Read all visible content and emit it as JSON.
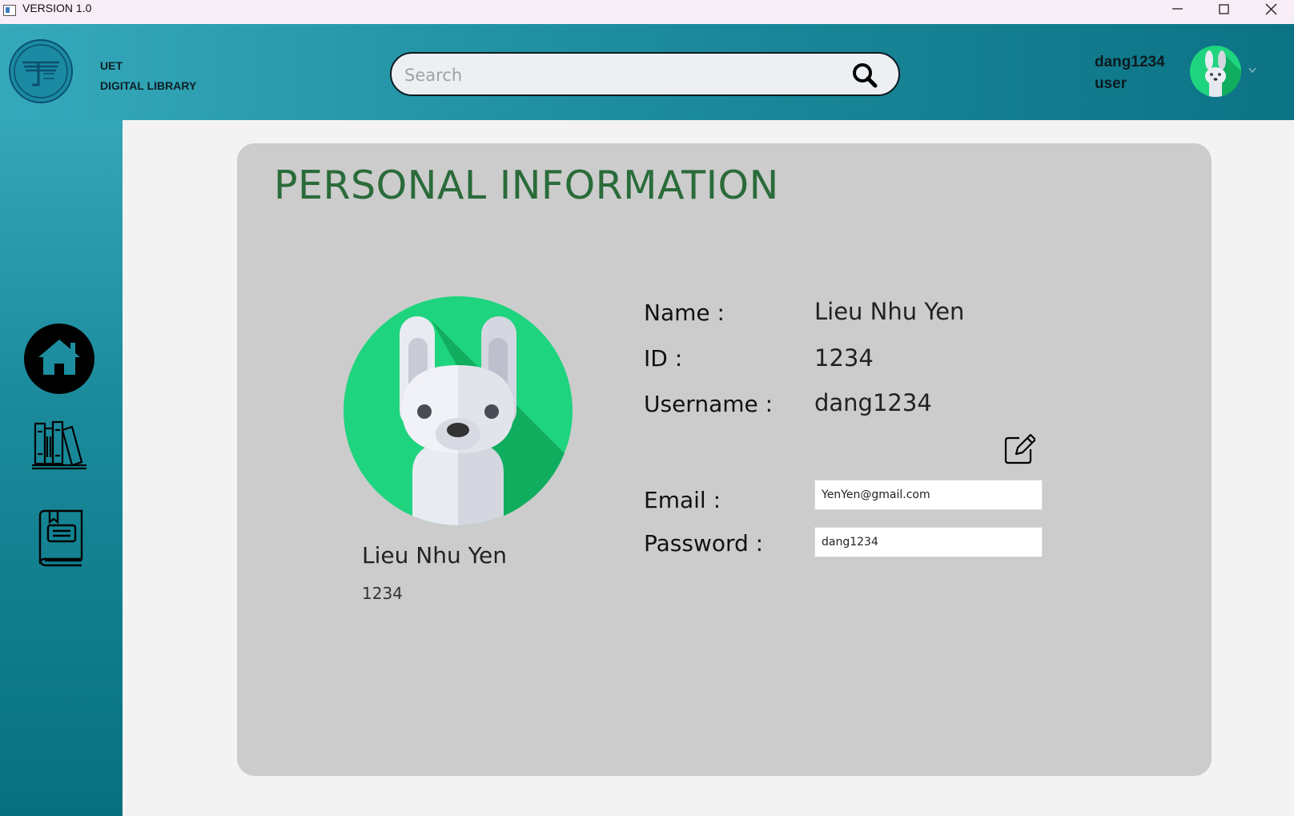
{
  "window": {
    "title": "VERSION 1.0"
  },
  "header": {
    "brand_line1": "UET",
    "brand_line2": "DIGITAL LIBRARY",
    "search_placeholder": "Search",
    "user_name": "dang1234",
    "user_role": "user"
  },
  "sidebar": {
    "items": [
      {
        "name": "home",
        "icon": "home-icon"
      },
      {
        "name": "library",
        "icon": "bookshelf-icon"
      },
      {
        "name": "my-books",
        "icon": "book-icon"
      }
    ]
  },
  "profile": {
    "title": "PERSONAL INFORMATION",
    "display_name": "Lieu Nhu Yen",
    "display_id": "1234",
    "name_label": "Name :",
    "name_value": "Lieu Nhu Yen",
    "id_label": "ID :",
    "id_value": "1234",
    "username_label": "Username :",
    "username_value": "dang1234",
    "email_label": "Email :",
    "email_value": "YenYen@gmail.com",
    "password_label": "Password :",
    "password_value": "dang1234"
  },
  "colors": {
    "header_start": "#35a9bb",
    "header_end": "#0c7385",
    "title_green": "#2a6b3a",
    "avatar_green": "#1fd47e",
    "card_bg": "#cccccc"
  }
}
